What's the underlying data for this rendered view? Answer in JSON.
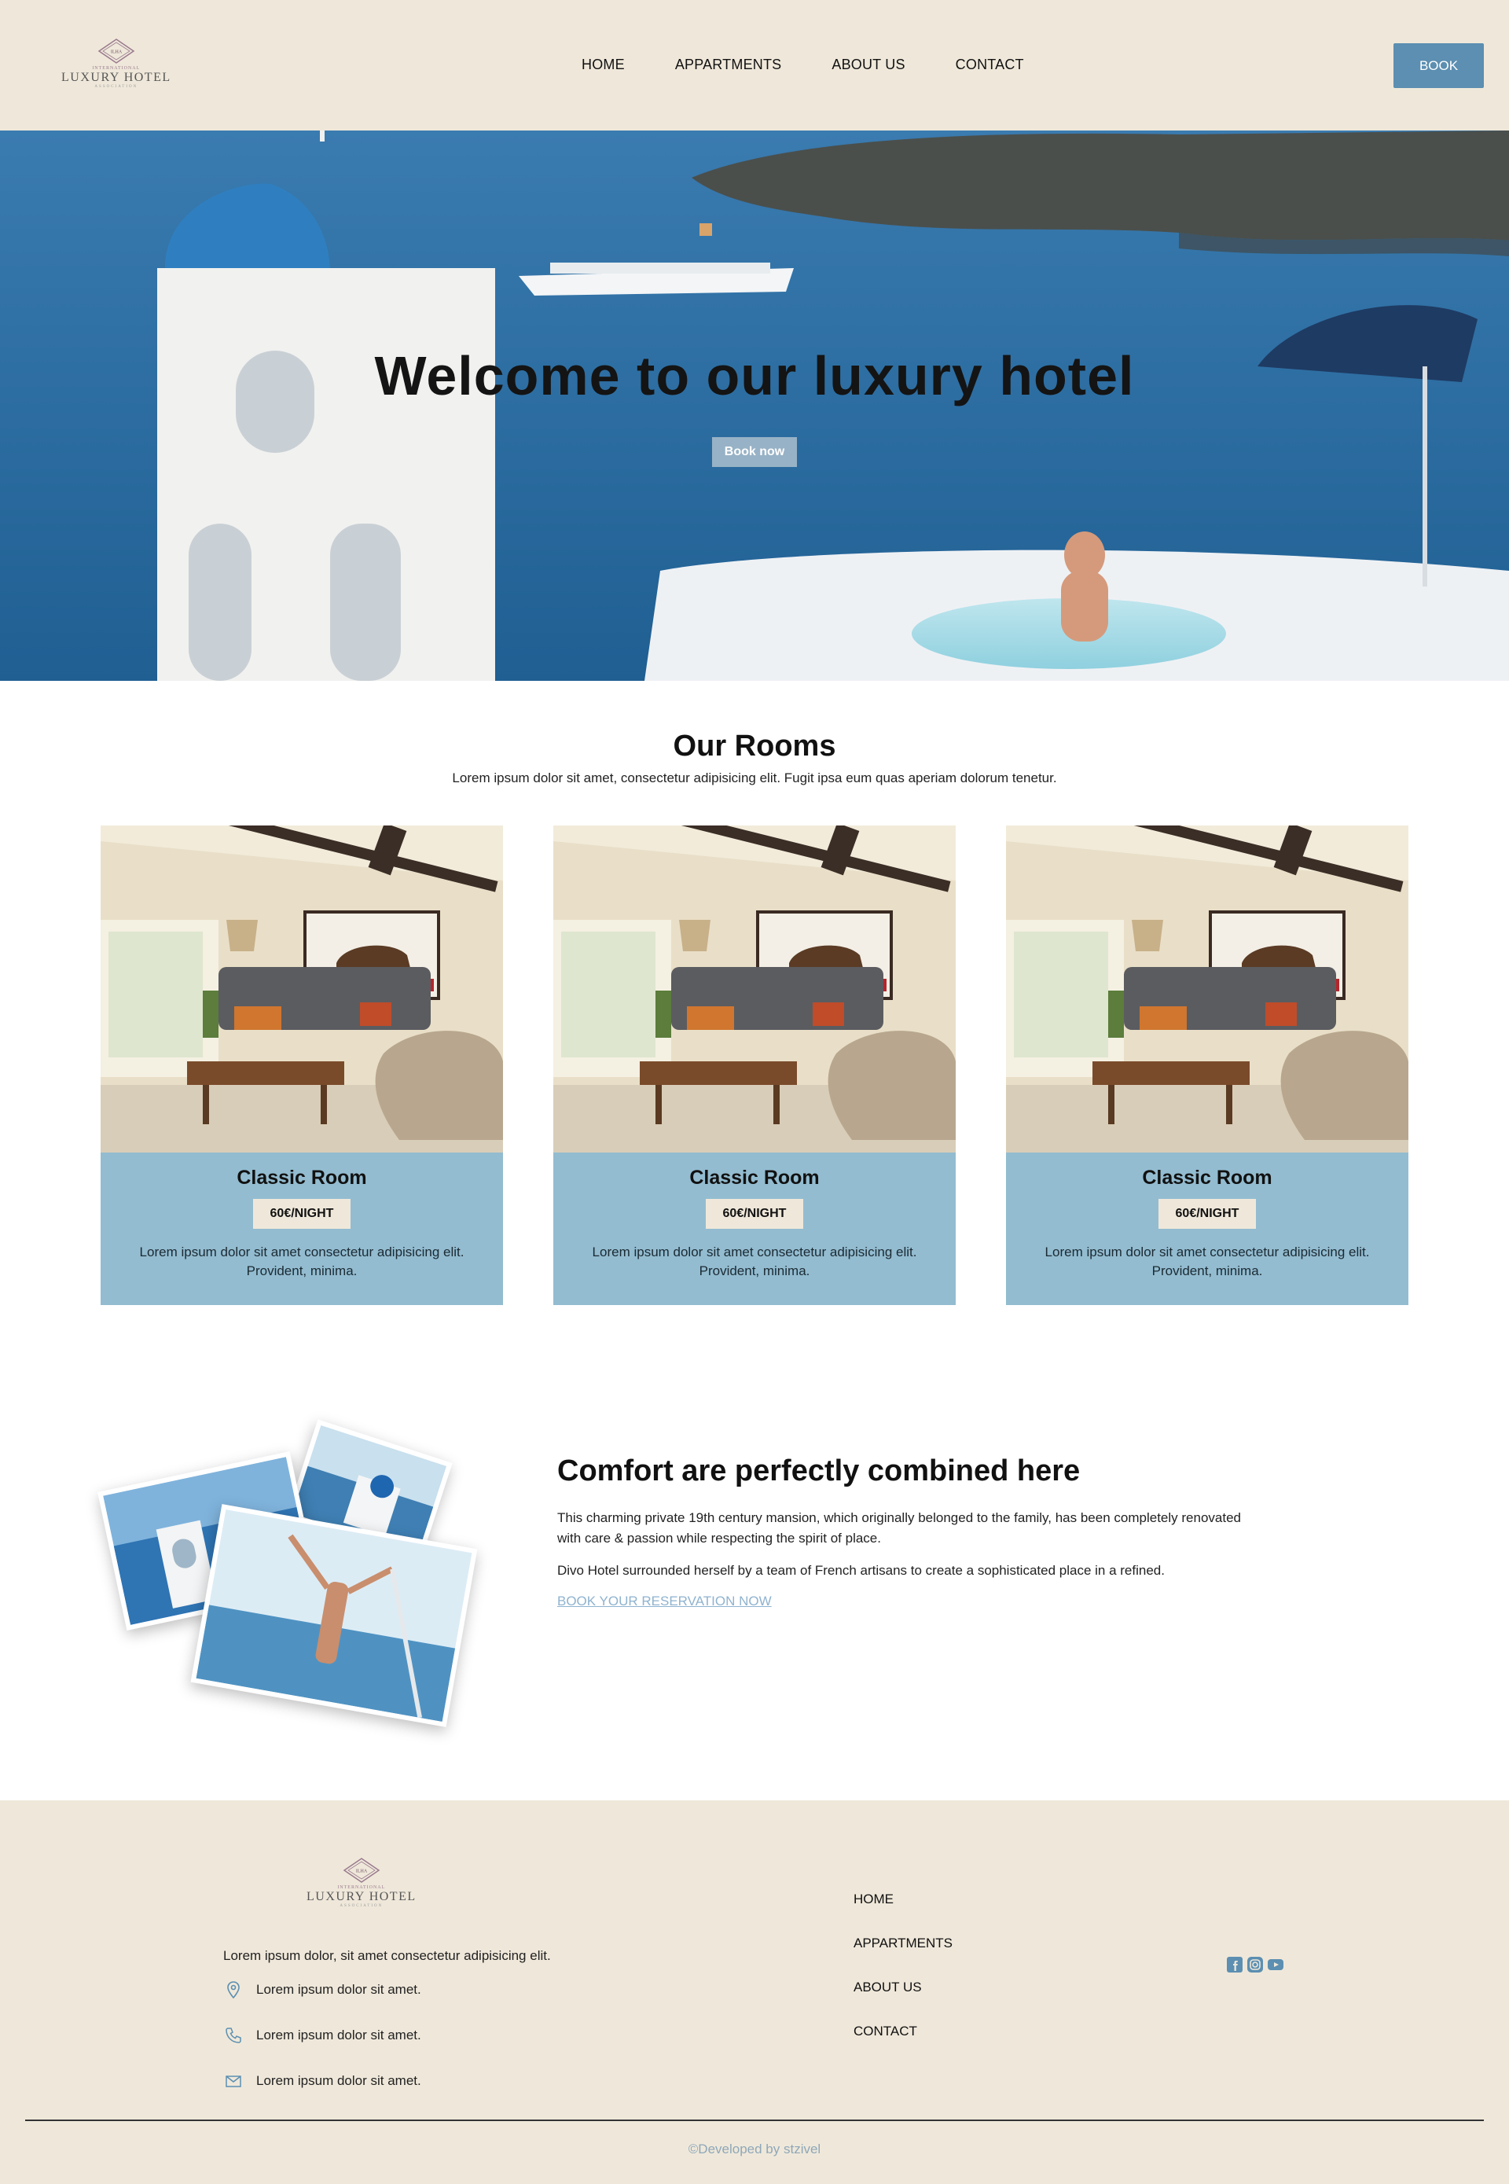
{
  "header": {
    "logo": {
      "small": "International",
      "big": "Luxury Hotel",
      "tiny": "Association",
      "mark": "ILHA"
    },
    "nav": [
      "HOME",
      "APPARTMENTS",
      "ABOUT US",
      "CONTACT"
    ],
    "book_label": "BOOK"
  },
  "hero": {
    "title": "Welcome to our luxury hotel",
    "button": "Book now"
  },
  "rooms": {
    "title": "Our Rooms",
    "subtitle": "Lorem ipsum dolor sit amet, consectetur adipisicing elit. Fugit ipsa eum quas aperiam dolorum tenetur.",
    "cards": [
      {
        "title": "Classic Room",
        "price": "60€/NIGHT",
        "desc": "Lorem ipsum dolor sit amet consectetur adipisicing elit. Provident, minima."
      },
      {
        "title": "Classic Room",
        "price": "60€/NIGHT",
        "desc": "Lorem ipsum dolor sit amet consectetur adipisicing elit. Provident, minima."
      },
      {
        "title": "Classic Room",
        "price": "60€/NIGHT",
        "desc": "Lorem ipsum dolor sit amet consectetur adipisicing elit. Provident, minima."
      }
    ]
  },
  "comfort": {
    "title": "Comfort are perfectly combined here",
    "p1": "This charming private 19th century mansion, which originally belonged to the family, has been completely renovated with care & passion while respecting the spirit of place.",
    "p2": "Divo Hotel surrounded herself by a team of French artisans to create a sophisticated place in a refined.",
    "link": "BOOK YOUR RESERVATION NOW"
  },
  "footer": {
    "desc": "Lorem ipsum dolor, sit amet consectetur adipisicing elit.",
    "contacts": [
      {
        "icon": "location-pin-icon",
        "text": "Lorem ipsum dolor sit amet."
      },
      {
        "icon": "phone-icon",
        "text": "Lorem ipsum dolor sit amet."
      },
      {
        "icon": "mail-icon",
        "text": "Lorem ipsum dolor sit amet."
      }
    ],
    "nav": [
      "HOME",
      "APPARTMENTS",
      "ABOUT US",
      "CONTACT"
    ],
    "socials": [
      "facebook-icon",
      "instagram-icon",
      "youtube-icon"
    ],
    "credit": "©Developed by stzivel"
  },
  "colors": {
    "header_bg": "#efe8da",
    "accent": "#5c8fb1",
    "card_bg": "#93bcd0",
    "link": "#8fb3cf"
  }
}
